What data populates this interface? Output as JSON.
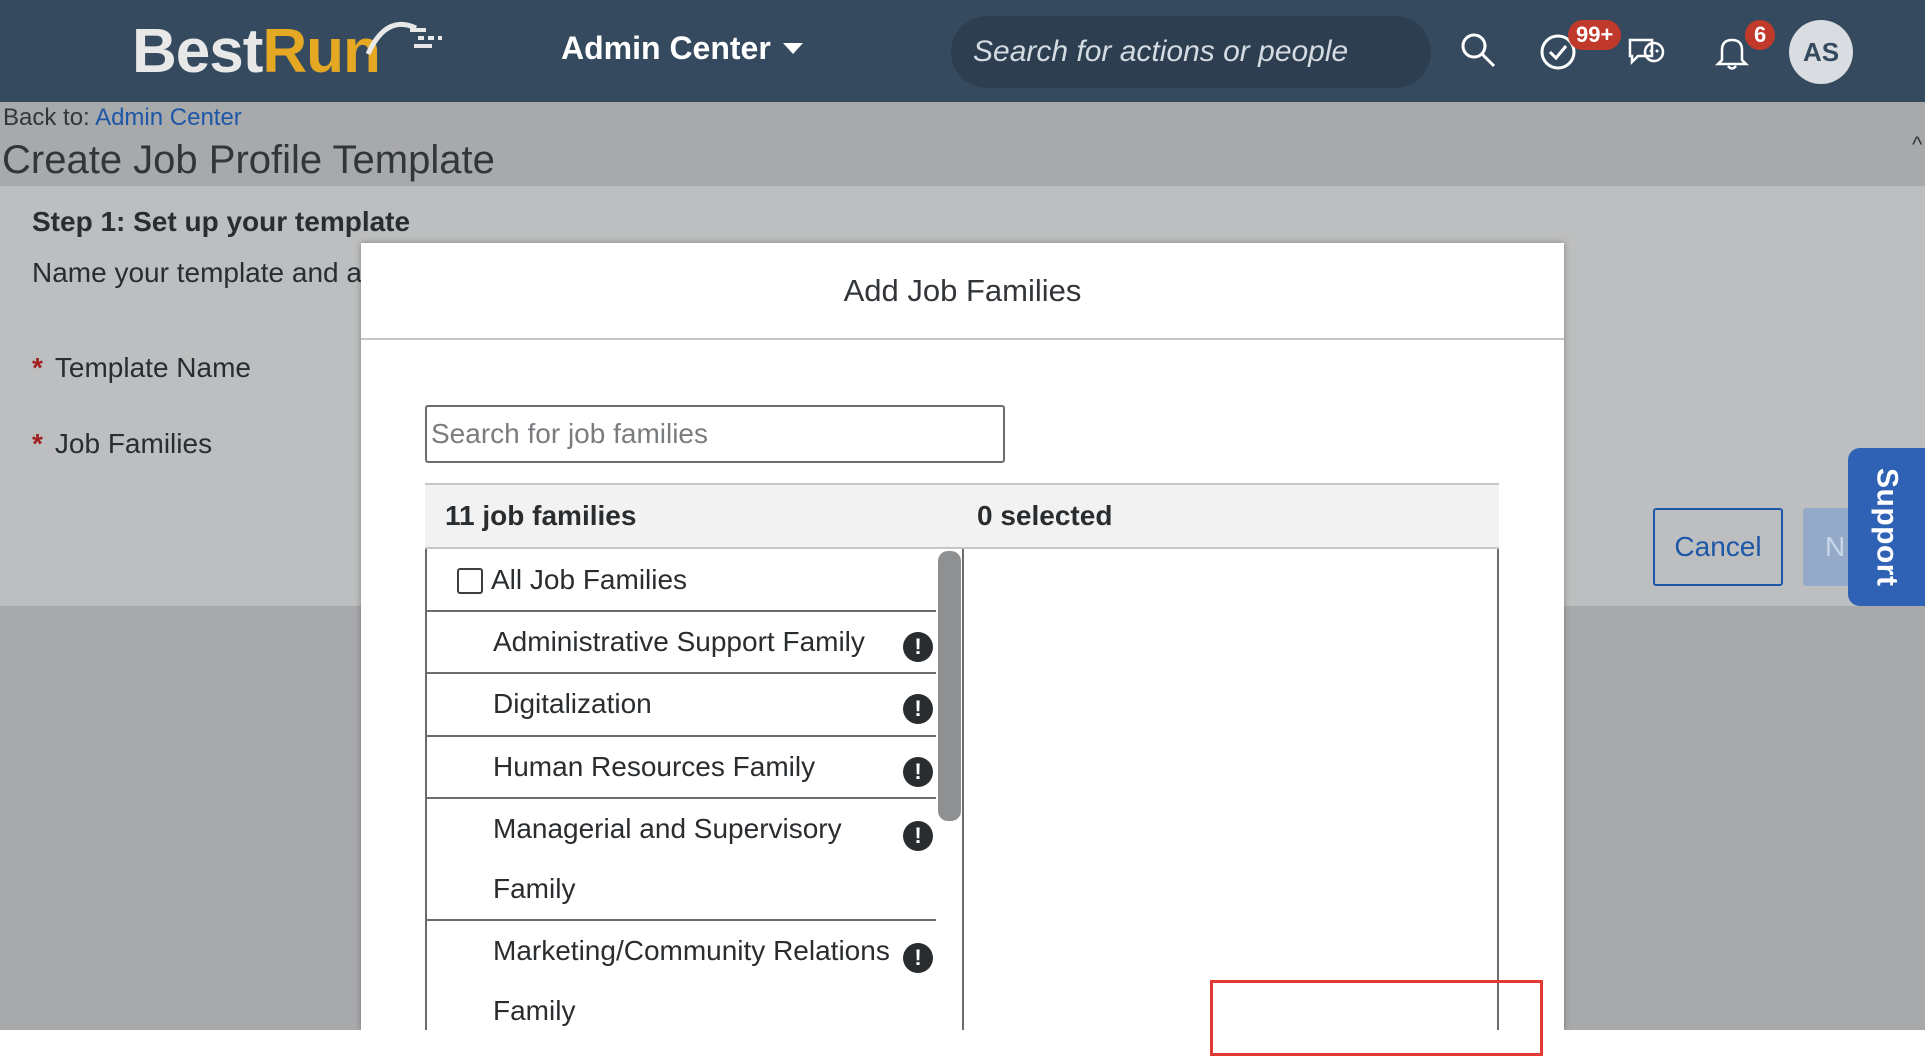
{
  "shell": {
    "logo_best": "Best",
    "logo_run": "Run",
    "admin_center_label": "Admin Center",
    "search_placeholder": "Search for actions or people",
    "todo_badge": "99+",
    "notification_badge": "6",
    "avatar_initials": "AS",
    "colors": {
      "bar": "#354a5f",
      "badge": "#c0392b",
      "logo_accent": "#e5a823"
    }
  },
  "page": {
    "back_to_prefix": "Back to:",
    "back_to_link": "Admin Center",
    "title": "Create Job Profile Template",
    "step_title": "Step 1: Set up your template",
    "step_desc": "Name your template and a",
    "fields": [
      {
        "label": "Template Name",
        "required": true
      },
      {
        "label": "Job Families",
        "required": true
      }
    ],
    "cancel_label": "Cancel",
    "next_label": "N",
    "support_label": "Support",
    "required_mark": "*"
  },
  "dialog": {
    "title": "Add Job Families",
    "search_placeholder": "Search for job families",
    "count_label": "11 job families",
    "selected_label": "0 selected",
    "all_label": "All Job Families",
    "items": [
      {
        "label": "Administrative Support Family",
        "warning": true
      },
      {
        "label": "Digitalization",
        "warning": true
      },
      {
        "label": "Human Resources Family",
        "warning": true
      },
      {
        "label": "Managerial and Supervisory",
        "label2": "Family",
        "warning": true
      },
      {
        "label": "Marketing/Community Relations",
        "label2": "Family",
        "warning": true
      }
    ],
    "warning_glyph": "!"
  }
}
